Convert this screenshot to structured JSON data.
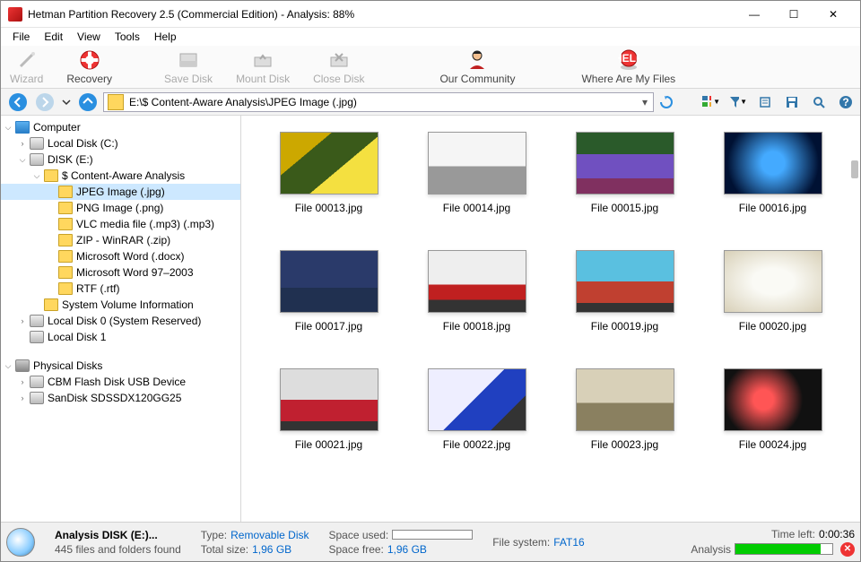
{
  "window": {
    "title": "Hetman Partition Recovery 2.5 (Commercial Edition) - Analysis: 88%"
  },
  "menu": {
    "file": "File",
    "edit": "Edit",
    "view": "View",
    "tools": "Tools",
    "help": "Help"
  },
  "toolbar1": {
    "wizard": "Wizard",
    "recovery": "Recovery",
    "save_disk": "Save Disk",
    "mount_disk": "Mount Disk",
    "close_disk": "Close Disk",
    "community": "Our Community",
    "where_files": "Where Are My Files"
  },
  "address": {
    "path": "E:\\$ Content-Aware Analysis\\JPEG Image (.jpg)"
  },
  "tree": {
    "computer": "Computer",
    "local_c": "Local Disk (C:)",
    "disk_e": "DISK (E:)",
    "content_aware": "$ Content-Aware Analysis",
    "jpeg": "JPEG Image (.jpg)",
    "png": "PNG Image (.png)",
    "vlc": "VLC media file (.mp3) (.mp3)",
    "zip": "ZIP - WinRAR (.zip)",
    "docx": "Microsoft Word (.docx)",
    "doc97": "Microsoft Word 97–2003",
    "rtf": "RTF (.rtf)",
    "svi": "System Volume Information",
    "local0": "Local Disk 0 (System Reserved)",
    "local1": "Local Disk 1",
    "physical": "Physical Disks",
    "cbm": "CBM Flash Disk USB Device",
    "sandisk": "SanDisk SDSSDX120GG25"
  },
  "files": [
    "File 00013.jpg",
    "File 00014.jpg",
    "File 00015.jpg",
    "File 00016.jpg",
    "File 00017.jpg",
    "File 00018.jpg",
    "File 00019.jpg",
    "File 00020.jpg",
    "File 00021.jpg",
    "File 00022.jpg",
    "File 00023.jpg",
    "File 00024.jpg"
  ],
  "thumbs": [
    "linear-gradient(140deg,#cca800 30%,#3a5a1a 30%,#3a5a1a 60%,#f4e040 60%)",
    "linear-gradient(#f5f5f5 55%,#999 55%)",
    "linear-gradient(#2a5a2a 35%,#7050c0 35%,#7050c0 75%,#803060 75%)",
    "radial-gradient(circle,#4af 20%,#013 80%)",
    "linear-gradient(#2a3a6a 60%,#203050 60%)",
    "linear-gradient(#eee 55%,#c02020 55%,#c02020 80%,#333 80%)",
    "linear-gradient(#5ac0e0 50%,#c04030 50%,#c04030 85%,#333 85%)",
    "radial-gradient(ellipse at center,#fafaf5 30%,#d8d0b8)",
    "linear-gradient(#ddd 50%,#c02030 50%,#c02030 85%,#333 85%)",
    "linear-gradient(135deg,#eef 48%,#2040c0 48%,#2040c0 78%,#333 78%)",
    "linear-gradient(#d8d0b8 55%,#8a8060 55%)",
    "radial-gradient(circle at 40% 50%,#f55 15%,#111 60%)"
  ],
  "status": {
    "analysis_title": "Analysis DISK (E:)...",
    "files_found": "445 files and folders found",
    "type_label": "Type:",
    "type_value": "Removable Disk",
    "total_label": "Total size:",
    "total_value": "1,96 GB",
    "used_label": "Space used:",
    "free_label": "Space free:",
    "free_value": "1,96 GB",
    "fs_label": "File system:",
    "fs_value": "FAT16",
    "time_label": "Time left:",
    "time_value": "0:00:36",
    "analysis_label": "Analysis"
  }
}
